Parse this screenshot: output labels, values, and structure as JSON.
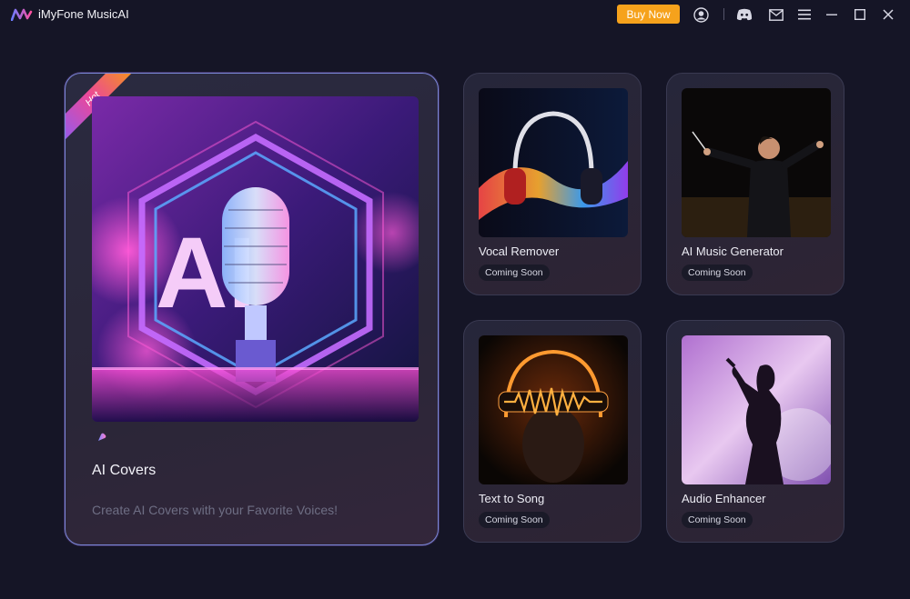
{
  "app": {
    "title": "iMyFone MusicAI"
  },
  "header": {
    "buy_label": "Buy Now",
    "icons": [
      "account-icon",
      "discord-icon",
      "mail-icon",
      "menu-icon",
      "minimize-icon",
      "maximize-icon",
      "close-icon"
    ]
  },
  "hero": {
    "ribbon": "Hot",
    "title": "AI Covers",
    "description": "Create AI Covers with your Favorite Voices!",
    "image_text": "AI"
  },
  "cards": [
    {
      "title": "Vocal Remover",
      "badge": "Coming Soon"
    },
    {
      "title": "AI Music Generator",
      "badge": "Coming Soon"
    },
    {
      "title": "Text to Song",
      "badge": "Coming Soon"
    },
    {
      "title": "Audio Enhancer",
      "badge": "Coming Soon"
    }
  ],
  "colors": {
    "background": "#151526",
    "buy_button": "#f6a21c",
    "hero_border": "#7a88d8"
  }
}
